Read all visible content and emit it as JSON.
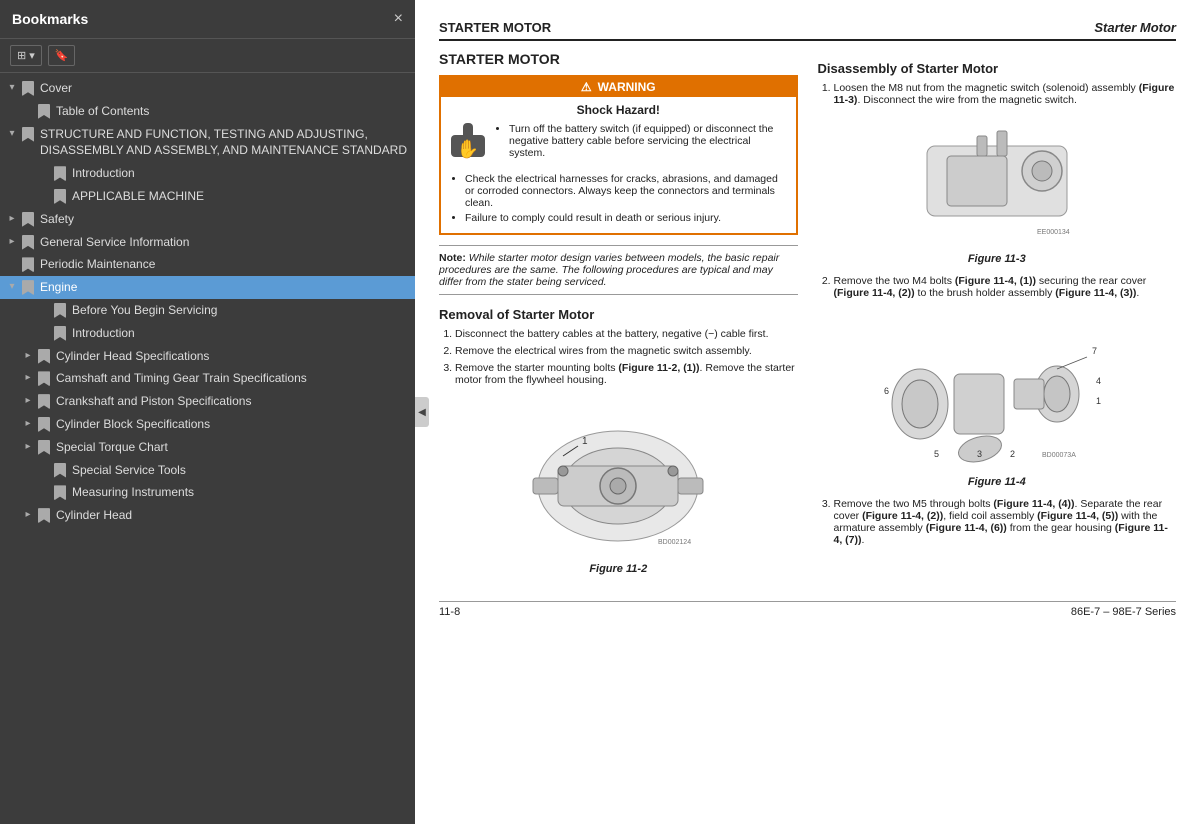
{
  "sidebar": {
    "title": "Bookmarks",
    "close_label": "×",
    "toolbar": {
      "btn1_label": "⊞ ▾",
      "btn2_label": "🔖"
    },
    "items": [
      {
        "id": "cover",
        "label": "Cover",
        "level": 0,
        "arrow": "down",
        "active": false
      },
      {
        "id": "toc",
        "label": "Table of Contents",
        "level": 1,
        "arrow": "none",
        "active": false
      },
      {
        "id": "structure",
        "label": "STRUCTURE AND FUNCTION, TESTING AND ADJUSTING, DISASSEMBLY AND ASSEMBLY, AND MAINTENANCE STANDARD",
        "level": 1,
        "arrow": "down",
        "active": false
      },
      {
        "id": "intro1",
        "label": "Introduction",
        "level": 2,
        "arrow": "none",
        "active": false
      },
      {
        "id": "applicable",
        "label": "APPLICABLE MACHINE",
        "level": 2,
        "arrow": "none",
        "active": false
      },
      {
        "id": "safety",
        "label": "Safety",
        "level": 1,
        "arrow": "right",
        "active": false
      },
      {
        "id": "general",
        "label": "General Service Information",
        "level": 1,
        "arrow": "right",
        "active": false
      },
      {
        "id": "periodic",
        "label": "Periodic Maintenance",
        "level": 1,
        "arrow": "none",
        "active": false
      },
      {
        "id": "engine",
        "label": "Engine",
        "level": 1,
        "arrow": "down",
        "active": true
      },
      {
        "id": "before",
        "label": "Before You Begin Servicing",
        "level": 2,
        "arrow": "none",
        "active": false
      },
      {
        "id": "intro2",
        "label": "Introduction",
        "level": 2,
        "arrow": "none",
        "active": false
      },
      {
        "id": "cylinder-head",
        "label": "Cylinder Head Specifications",
        "level": 2,
        "arrow": "right",
        "active": false
      },
      {
        "id": "camshaft",
        "label": "Camshaft and Timing Gear Train Specifications",
        "level": 2,
        "arrow": "right",
        "active": false
      },
      {
        "id": "crankshaft",
        "label": "Crankshaft and Piston Specifications",
        "level": 2,
        "arrow": "right",
        "active": false
      },
      {
        "id": "cylinder-block",
        "label": "Cylinder Block Specifications",
        "level": 2,
        "arrow": "right",
        "active": false
      },
      {
        "id": "special-torque",
        "label": "Special Torque Chart",
        "level": 2,
        "arrow": "right",
        "active": false
      },
      {
        "id": "special-service",
        "label": "Special Service Tools",
        "level": 2,
        "arrow": "none",
        "active": false
      },
      {
        "id": "measuring",
        "label": "Measuring Instruments",
        "level": 2,
        "arrow": "none",
        "active": false
      },
      {
        "id": "cylinder-head2",
        "label": "Cylinder Head",
        "level": 2,
        "arrow": "right",
        "active": false
      }
    ]
  },
  "main": {
    "header_left": "STARTER MOTOR",
    "header_right": "Starter Motor",
    "section_title": "STARTER MOTOR",
    "warning": {
      "header": "⚠ WARNING",
      "shock_title": "Shock Hazard!",
      "bullets": [
        "Turn off the battery switch (if equipped) or disconnect the negative battery cable before servicing the electrical system.",
        "Check the electrical harnesses for cracks, abrasions, and damaged or corroded connectors. Always keep the connectors and terminals clean.",
        "Failure to comply could result in death or serious injury."
      ]
    },
    "note": "Note:  While starter motor design varies between models, the basic repair procedures are the same. The following procedures are typical and may differ from the stater being serviced.",
    "removal_title": "Removal of Starter Motor",
    "removal_steps": [
      "Disconnect the battery cables at the battery, negative (−) cable first.",
      "Remove the electrical wires from the magnetic switch assembly.",
      "Remove the starter mounting bolts (Figure 11-2, (1)). Remove the starter motor from the flywheel housing."
    ],
    "figure2_label": "Figure 11-2",
    "disassembly_title": "Disassembly of Starter Motor",
    "disassembly_steps": [
      "Loosen the M8 nut from the magnetic switch (solenoid) assembly (Figure 11-3). Disconnect the wire from the magnetic switch.",
      "Remove the two M4 bolts (Figure 11-4, (1)) securing the rear cover (Figure 11-4, (2)) to the brush holder assembly (Figure 11-4, (3)).",
      "Remove the two M5 through bolts (Figure 11-4, (4)). Separate the rear cover (Figure 11-4, (2)), field coil assembly (Figure 11-4, (5)) with the armature assembly (Figure 11-4, (6)) from the gear housing (Figure 11-4, (7))."
    ],
    "figure3_label": "Figure 11-3",
    "figure4_label": "Figure 11-4",
    "footer_left": "11-8",
    "footer_right": "86E-7 – 98E-7 Series"
  }
}
